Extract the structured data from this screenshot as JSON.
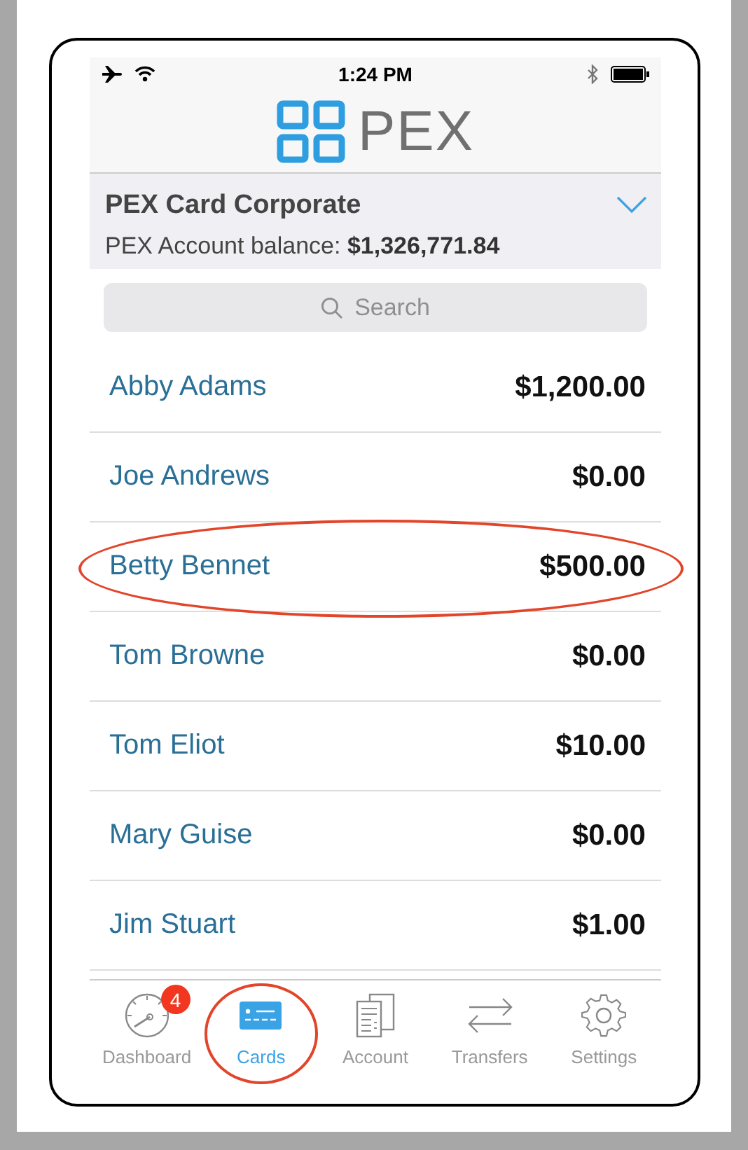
{
  "status_bar": {
    "time": "1:24 PM"
  },
  "logo": {
    "text": "PEX"
  },
  "account": {
    "name": "PEX Card Corporate",
    "balance_label": "PEX Account balance: ",
    "balance": "$1,326,771.84",
    "expanded": false
  },
  "search": {
    "placeholder": "Search"
  },
  "cards": [
    {
      "name": "Abby Adams",
      "amount": "$1,200.00",
      "circled": false
    },
    {
      "name": "Joe Andrews",
      "amount": "$0.00",
      "circled": false
    },
    {
      "name": "Betty Bennet",
      "amount": "$500.00",
      "circled": true
    },
    {
      "name": "Tom Browne",
      "amount": "$0.00",
      "circled": false
    },
    {
      "name": "Tom Eliot",
      "amount": "$10.00",
      "circled": false
    },
    {
      "name": "Mary Guise",
      "amount": "$0.00",
      "circled": false
    },
    {
      "name": "Jim Stuart",
      "amount": "$1.00",
      "circled": false
    }
  ],
  "tabs": [
    {
      "kind": "dashboard",
      "label": "Dashboard",
      "selected": false,
      "badge": "4",
      "circled": false
    },
    {
      "kind": "cards",
      "label": "Cards",
      "selected": true,
      "circled": true
    },
    {
      "kind": "account",
      "label": "Account",
      "selected": false,
      "circled": false
    },
    {
      "kind": "transfers",
      "label": "Transfers",
      "selected": false,
      "circled": false
    },
    {
      "kind": "settings",
      "label": "Settings",
      "selected": false,
      "circled": false
    }
  ]
}
